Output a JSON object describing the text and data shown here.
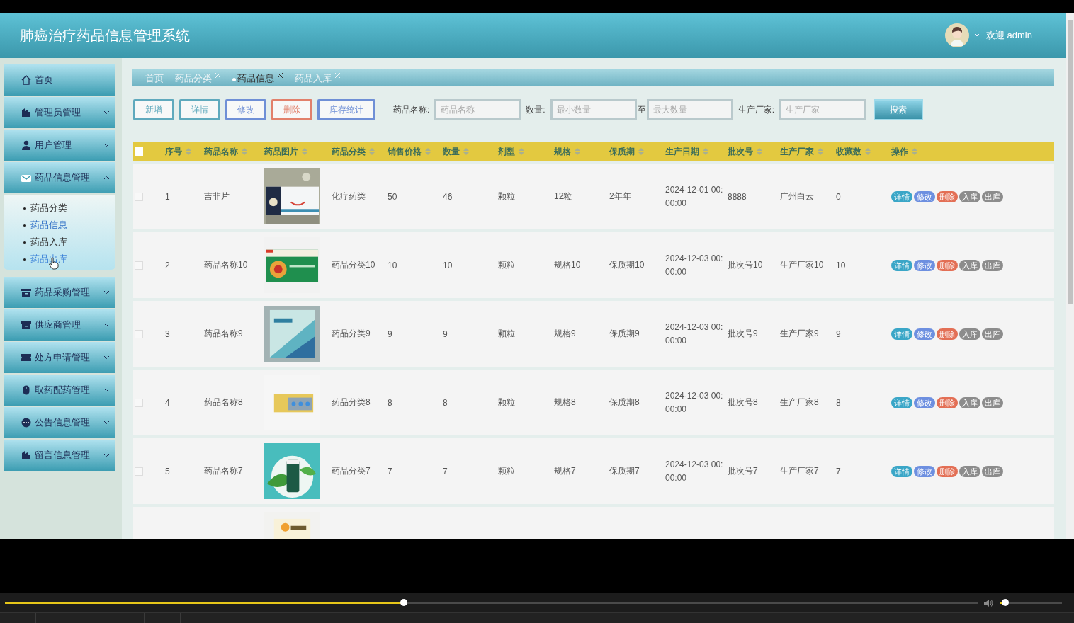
{
  "window": {
    "title": "肺癌治疗药品信息管理系统"
  },
  "user": {
    "greeting": "欢迎 admin"
  },
  "menu": [
    {
      "label": "首页",
      "expandable": false
    },
    {
      "label": "管理员管理",
      "expandable": true,
      "expanded": false
    },
    {
      "label": "用户管理",
      "expandable": true,
      "expanded": false
    },
    {
      "label": "药品信息管理",
      "expandable": true,
      "expanded": true,
      "children": [
        {
          "label": "药品分类",
          "selected": false,
          "hovered": false
        },
        {
          "label": "药品信息",
          "selected": true,
          "hovered": false
        },
        {
          "label": "药品入库",
          "selected": false,
          "hovered": false
        },
        {
          "label": "药品出库",
          "selected": false,
          "hovered": true
        }
      ]
    },
    {
      "label": "药品采购管理",
      "expandable": true,
      "expanded": false
    },
    {
      "label": "供应商管理",
      "expandable": true,
      "expanded": false
    },
    {
      "label": "处方申请管理",
      "expandable": true,
      "expanded": false
    },
    {
      "label": "取药配药管理",
      "expandable": true,
      "expanded": false
    },
    {
      "label": "公告信息管理",
      "expandable": true,
      "expanded": false
    },
    {
      "label": "留言信息管理",
      "expandable": true,
      "expanded": false
    }
  ],
  "tabs": [
    {
      "label": "首页",
      "selected": false,
      "closable": false
    },
    {
      "label": "药品分类",
      "selected": false,
      "closable": true
    },
    {
      "label": "药品信息",
      "selected": true,
      "closable": true
    },
    {
      "label": "药品入库",
      "selected": false,
      "closable": true
    }
  ],
  "toolbar": {
    "buttons": [
      {
        "label": "新增",
        "color": "#5fa9bd"
      },
      {
        "label": "详情",
        "color": "#5fa9bd"
      },
      {
        "label": "修改",
        "color": "#6f8fd6"
      },
      {
        "label": "删除",
        "color": "#e2806b"
      },
      {
        "label": "库存统计",
        "color": "#6f8fd6"
      }
    ],
    "filters": {
      "name_label": "药品名称:",
      "name_placeholder": "药品名称",
      "qty_label": "数量:",
      "min_placeholder": "最小数量",
      "range_sep": "至",
      "max_placeholder": "最大数量",
      "maker_label": "生产厂家:",
      "maker_placeholder": "生产厂家"
    },
    "search_button": "搜索"
  },
  "table": {
    "select_all": false,
    "columns": [
      "序号",
      "药品名称",
      "药品图片",
      "药品分类",
      "销售价格",
      "数量",
      "剂型",
      "规格",
      "保质期",
      "生产日期",
      "批次号",
      "生产厂家",
      "收藏数",
      "操作"
    ],
    "rows": [
      {
        "checked": false,
        "cells": [
          "1",
          "吉非片",
          {
            "kind": "picture"
          },
          "化疗药类",
          "50",
          "46",
          "颗粒",
          "12粒",
          "2年年",
          "2024-12-01 00:00:00",
          "8888",
          "广州白云",
          "0"
        ],
        "actions": [
          {
            "label": "详情",
            "color": "#3aa6c7"
          },
          {
            "label": "修改",
            "color": "#6d8fe0"
          },
          {
            "label": "删除",
            "color": "#e36f55"
          },
          {
            "label": "入库",
            "color": "#8c8c8c"
          },
          {
            "label": "出库",
            "color": "#8c8c8c"
          }
        ]
      },
      {
        "checked": false,
        "cells": [
          "2",
          "药品名称10",
          {
            "kind": "picture"
          },
          "药品分类10",
          "10",
          "10",
          "颗粒",
          "规格10",
          "保质期10",
          "2024-12-03 00:00:00",
          "批次号10",
          "生产厂家10",
          "10"
        ],
        "actions": [
          {
            "label": "详情",
            "color": "#3aa6c7"
          },
          {
            "label": "修改",
            "color": "#6d8fe0"
          },
          {
            "label": "删除",
            "color": "#e36f55"
          },
          {
            "label": "入库",
            "color": "#8c8c8c"
          },
          {
            "label": "出库",
            "color": "#8c8c8c"
          }
        ]
      },
      {
        "checked": false,
        "cells": [
          "3",
          "药品名称9",
          {
            "kind": "picture"
          },
          "药品分类9",
          "9",
          "9",
          "颗粒",
          "规格9",
          "保质期9",
          "2024-12-03 00:00:00",
          "批次号9",
          "生产厂家9",
          "9"
        ],
        "actions": [
          {
            "label": "详情",
            "color": "#3aa6c7"
          },
          {
            "label": "修改",
            "color": "#6d8fe0"
          },
          {
            "label": "删除",
            "color": "#e36f55"
          },
          {
            "label": "入库",
            "color": "#8c8c8c"
          },
          {
            "label": "出库",
            "color": "#8c8c8c"
          }
        ]
      },
      {
        "checked": false,
        "cells": [
          "4",
          "药品名称8",
          {
            "kind": "picture"
          },
          "药品分类8",
          "8",
          "8",
          "颗粒",
          "规格8",
          "保质期8",
          "2024-12-03 00:00:00",
          "批次号8",
          "生产厂家8",
          "8"
        ],
        "actions": [
          {
            "label": "详情",
            "color": "#3aa6c7"
          },
          {
            "label": "修改",
            "color": "#6d8fe0"
          },
          {
            "label": "删除",
            "color": "#e36f55"
          },
          {
            "label": "入库",
            "color": "#8c8c8c"
          },
          {
            "label": "出库",
            "color": "#8c8c8c"
          }
        ]
      },
      {
        "checked": false,
        "cells": [
          "5",
          "药品名称7",
          {
            "kind": "picture"
          },
          "药品分类7",
          "7",
          "7",
          "颗粒",
          "规格7",
          "保质期7",
          "2024-12-03 00:00:00",
          "批次号7",
          "生产厂家7",
          "7"
        ],
        "actions": [
          {
            "label": "详情",
            "color": "#3aa6c7"
          },
          {
            "label": "修改",
            "color": "#6d8fe0"
          },
          {
            "label": "删除",
            "color": "#e36f55"
          },
          {
            "label": "入库",
            "color": "#8c8c8c"
          },
          {
            "label": "出库",
            "color": "#8c8c8c"
          }
        ]
      }
    ]
  },
  "player": {
    "progress": {
      "level": 0.41
    },
    "volume": {
      "level": 0.08
    }
  }
}
